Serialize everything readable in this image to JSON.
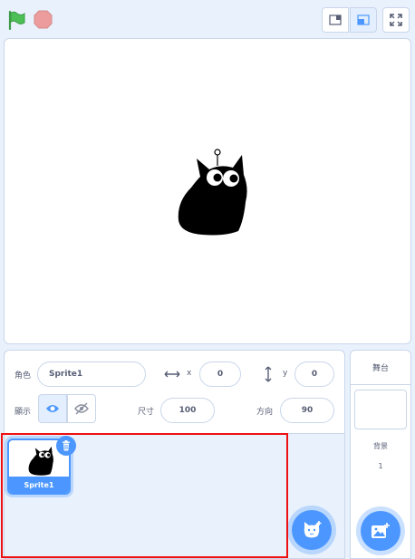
{
  "colors": {
    "accent": "#4c97ff",
    "flag": "#4cbf56",
    "stop": "#ec9c9c",
    "highlight": "#e11111"
  },
  "icons": {
    "flag": "green-flag-icon",
    "stop": "stop-icon",
    "small_stage": "small-stage-icon",
    "large_stage": "large-stage-icon",
    "fullscreen": "fullscreen-icon",
    "show": "eye-icon",
    "hide": "eye-slash-icon",
    "delete": "trash-icon",
    "add_sprite": "cat-plus-icon",
    "add_backdrop": "image-plus-icon"
  },
  "sprite_info": {
    "sprite_label": "角色",
    "sprite_name": "Sprite1",
    "x_label": "x",
    "x_value": "0",
    "y_label": "y",
    "y_value": "0",
    "show_label": "顯示",
    "size_label": "尺寸",
    "size_value": "100",
    "direction_label": "方向",
    "direction_value": "90"
  },
  "sprite_list": {
    "items": [
      {
        "name": "Sprite1"
      }
    ]
  },
  "stage_panel": {
    "title": "舞台",
    "backdrops_label": "背景",
    "backdrops_count": "1"
  }
}
